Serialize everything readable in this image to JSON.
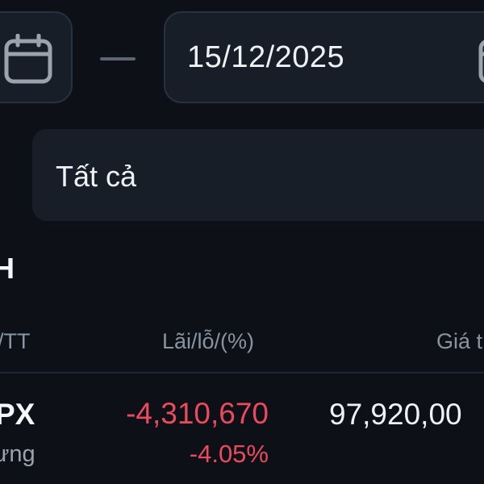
{
  "date_range": {
    "from_value": "",
    "to_value": "15/12/2025"
  },
  "filter": {
    "selected": "Tất cả"
  },
  "section": {
    "title": "H"
  },
  "table": {
    "headers": {
      "left": "/TT",
      "profit_loss": "Lãi/lỗ/(%)",
      "price": "Giá t"
    },
    "rows": [
      {
        "symbol": "PX",
        "sub": "ưng",
        "profit_loss": "-4,310,670",
        "profit_loss_pct": "-4.05%",
        "value": "97,920,00"
      }
    ]
  },
  "colors": {
    "background": "#0d1117",
    "card": "#171e28",
    "negative": "#ea4a5d",
    "muted_text": "#8a94a1"
  },
  "icons": {
    "from_calendar": "calendar-icon",
    "to_calendar": "calendar-icon"
  }
}
